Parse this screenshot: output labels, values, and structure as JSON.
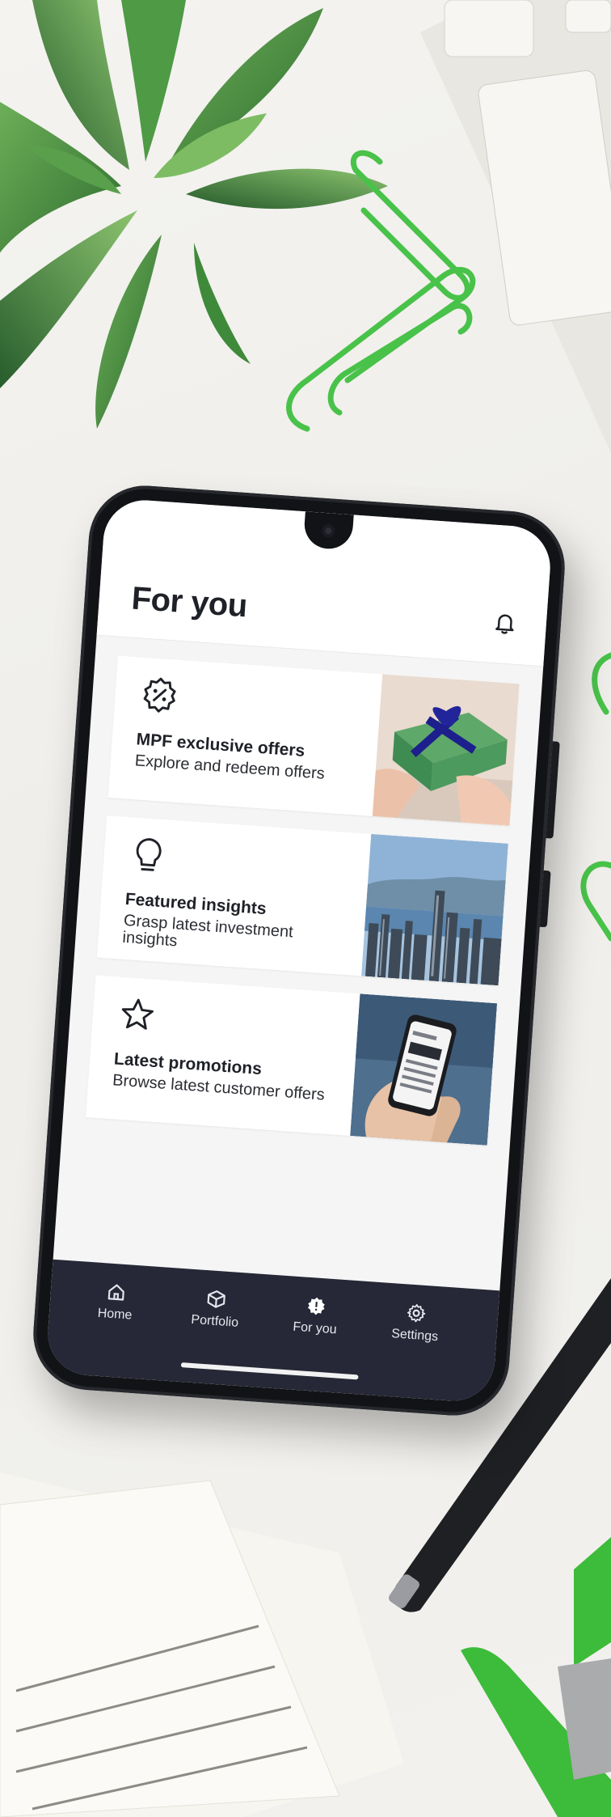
{
  "header": {
    "title": "For you",
    "notification_icon": "bell-icon"
  },
  "cards": [
    {
      "icon": "discount-badge-icon",
      "title": "MPF exclusive offers",
      "subtitle": "Explore and redeem offers",
      "photo": "gift-photo"
    },
    {
      "icon": "lightbulb-icon",
      "title": "Featured insights",
      "subtitle": "Grasp latest investment insights",
      "photo": "city-skyline-photo"
    },
    {
      "icon": "star-icon",
      "title": "Latest promotions",
      "subtitle": "Browse latest customer offers",
      "photo": "phone-in-hand-photo"
    }
  ],
  "tabbar": {
    "items": [
      {
        "label": "Home",
        "icon": "home-icon",
        "active": false
      },
      {
        "label": "Portfolio",
        "icon": "box-icon",
        "active": false
      },
      {
        "label": "For you",
        "icon": "for-you-badge-icon",
        "active": true
      },
      {
        "label": "Settings",
        "icon": "gear-icon",
        "active": false
      }
    ]
  },
  "colors": {
    "tabbar_bg": "#262837",
    "accent_green": "#3dbb3a",
    "text_dark": "#1f2128"
  }
}
